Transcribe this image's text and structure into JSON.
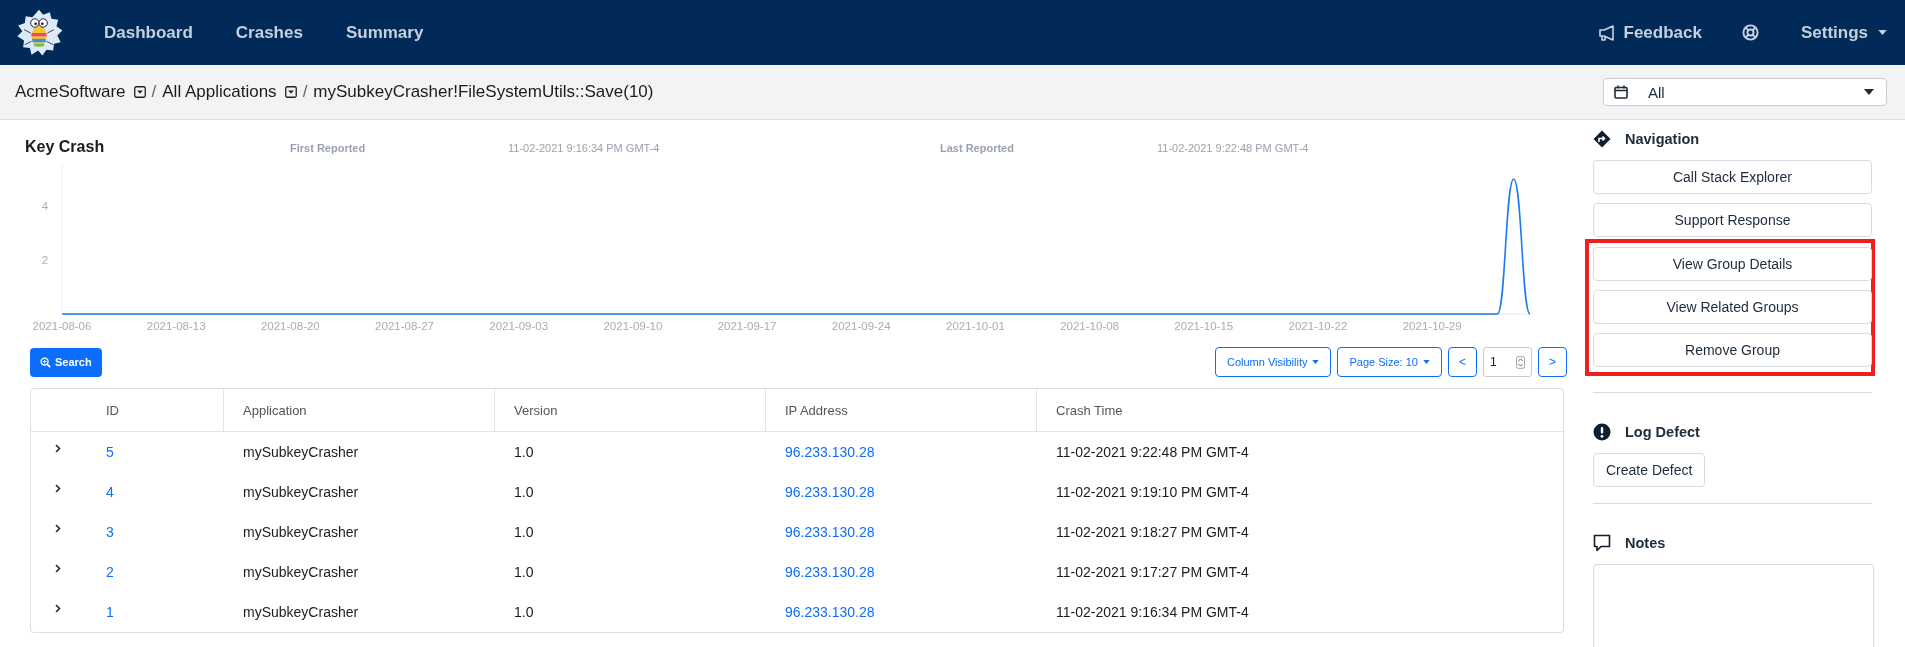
{
  "navbar": {
    "links": [
      {
        "label": "Dashboard"
      },
      {
        "label": "Crashes"
      },
      {
        "label": "Summary"
      }
    ],
    "feedback": "Feedback",
    "settings": "Settings"
  },
  "breadcrumb": [
    {
      "label": "AcmeSoftware",
      "dropdown": true,
      "separator": "/"
    },
    {
      "label": "All Applications",
      "dropdown": true,
      "separator": "/"
    },
    {
      "label": "mySubkeyCrasher!FileSystemUtils::Save(10)",
      "dropdown": false
    }
  ],
  "date_filter": {
    "value": "All"
  },
  "chart_panel": {
    "title": "Key Crash",
    "first_reported_label": "First Reported",
    "first_reported": "11-02-2021 9:16:34 PM GMT-4",
    "last_reported_label": "Last Reported",
    "last_reported": "11-02-2021 9:22:48 PM GMT-4",
    "chart_data": {
      "type": "line",
      "x": [
        "2021-08-06",
        "2021-11-02",
        "2021-11-03",
        "2021-11-04"
      ],
      "series": [
        {
          "color": "#1a7cf0",
          "values": [
            0,
            0,
            5,
            0
          ]
        }
      ],
      "xlim": [
        "2021-08-06",
        "2021-11-04"
      ],
      "ylim": [
        0,
        5.6
      ],
      "yticks": [
        {
          "value": 2,
          "label": "2"
        },
        {
          "value": 4,
          "label": "4"
        }
      ],
      "xticks": [
        "2021-08-06",
        "2021-08-13",
        "2021-08-20",
        "2021-08-27",
        "2021-09-03",
        "2021-09-10",
        "2021-09-17",
        "2021-09-24",
        "2021-10-01",
        "2021-10-08",
        "2021-10-15",
        "2021-10-22",
        "2021-10-29"
      ]
    }
  },
  "toolbar": {
    "search": "Search",
    "column_visibility": "Column Visibility",
    "page_size": "Page Size: 10",
    "prev": "<",
    "page": "1",
    "next": ">"
  },
  "table": {
    "columns": [
      "ID",
      "Application",
      "Version",
      "IP Address",
      "Crash Time"
    ],
    "rows": [
      {
        "expanded": false,
        "id": "5",
        "application": "mySubkeyCrasher",
        "version": "1.0",
        "ip": "96.233.130.28",
        "crash_time": "11-02-2021 9:22:48 PM GMT-4"
      },
      {
        "expanded": false,
        "id": "4",
        "application": "mySubkeyCrasher",
        "version": "1.0",
        "ip": "96.233.130.28",
        "crash_time": "11-02-2021 9:19:10 PM GMT-4"
      },
      {
        "expanded": false,
        "id": "3",
        "application": "mySubkeyCrasher",
        "version": "1.0",
        "ip": "96.233.130.28",
        "crash_time": "11-02-2021 9:18:27 PM GMT-4"
      },
      {
        "expanded": false,
        "id": "2",
        "application": "mySubkeyCrasher",
        "version": "1.0",
        "ip": "96.233.130.28",
        "crash_time": "11-02-2021 9:17:27 PM GMT-4"
      },
      {
        "expanded": false,
        "id": "1",
        "application": "mySubkeyCrasher",
        "version": "1.0",
        "ip": "96.233.130.28",
        "crash_time": "11-02-2021 9:16:34 PM GMT-4"
      }
    ]
  },
  "sidebar": {
    "navigation": {
      "title": "Navigation",
      "buttons": [
        {
          "label": "Call Stack Explorer",
          "highlighted": false
        },
        {
          "label": "Support Response",
          "highlighted": false
        },
        {
          "label": "View Group Details",
          "highlighted": true
        },
        {
          "label": "View Related Groups",
          "highlighted": true
        },
        {
          "label": "Remove Group",
          "highlighted": true
        }
      ]
    },
    "log_defect": {
      "title": "Log Defect",
      "button": "Create Defect"
    },
    "notes": {
      "title": "Notes"
    }
  }
}
